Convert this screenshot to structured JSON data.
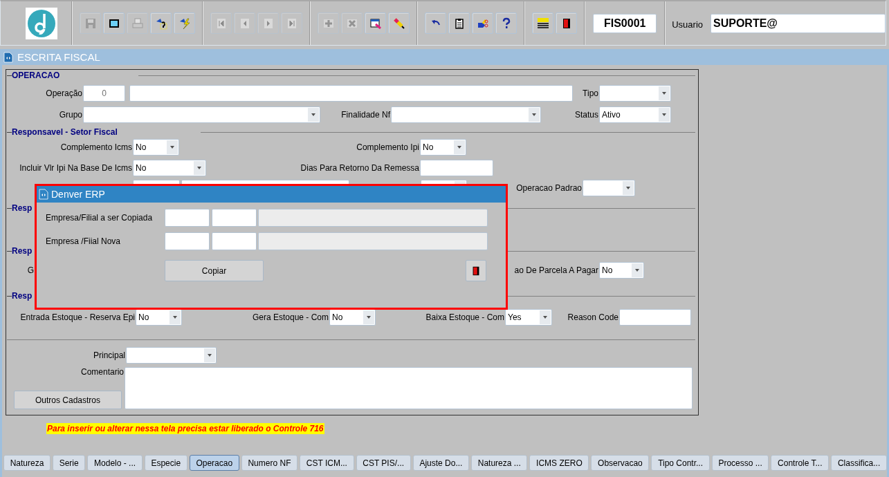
{
  "toolbar": {
    "groups": [
      {
        "buttons": [
          {
            "kind": "save",
            "disabled": true
          },
          {
            "kind": "window",
            "disabled": false
          },
          {
            "kind": "print",
            "disabled": true
          },
          {
            "kind": "query",
            "disabled": false
          },
          {
            "kind": "execute",
            "disabled": false
          }
        ]
      },
      {
        "buttons": [
          {
            "kind": "first",
            "disabled": true
          },
          {
            "kind": "prev",
            "disabled": true
          },
          {
            "kind": "next",
            "disabled": true
          },
          {
            "kind": "last",
            "disabled": true
          }
        ]
      },
      {
        "buttons": [
          {
            "kind": "insert",
            "disabled": true
          },
          {
            "kind": "delete",
            "disabled": true
          },
          {
            "kind": "edit",
            "disabled": false
          },
          {
            "kind": "clear",
            "disabled": false
          }
        ]
      },
      {
        "buttons": [
          {
            "kind": "undo",
            "disabled": false
          },
          {
            "kind": "clipboard",
            "disabled": false
          },
          {
            "kind": "hand",
            "disabled": false
          },
          {
            "kind": "help",
            "disabled": false
          }
        ]
      },
      {
        "buttons": [
          {
            "kind": "menu",
            "disabled": false
          },
          {
            "kind": "exit",
            "disabled": false
          }
        ]
      }
    ],
    "screen_code": "FIS0001",
    "user_label": "Usuario",
    "user": "SUPORTE@"
  },
  "window": {
    "title": "ESCRITA FISCAL"
  },
  "form": {
    "sections": [
      {
        "title": "OPERACAO",
        "rows": [
          [
            {
              "label": "Operação",
              "kind": "code",
              "value": "0"
            },
            {
              "kind": "text"
            },
            {
              "label": "Tipo",
              "kind": "combo"
            }
          ],
          [
            {
              "label": "Grupo",
              "kind": "combo"
            },
            {
              "label": "Finalidade Nf",
              "kind": "combo"
            },
            {
              "label": "Status",
              "kind": "combo",
              "value": "Ativo"
            }
          ]
        ]
      },
      {
        "title": "Responsavel - Setor Fiscal",
        "rows": [
          [
            {
              "label": "Complemento Icms",
              "kind": "combo",
              "value": "No"
            },
            {
              "label": "Complemento Ipi",
              "kind": "combo",
              "value": "No"
            }
          ],
          [
            {
              "label": "Incluir Vlr Ipi Na Base De Icms",
              "kind": "combo",
              "value": "No"
            },
            {
              "label": "Dias Para Retorno Da Remessa",
              "kind": "text"
            }
          ],
          [
            {
              "kind": "text"
            },
            {
              "kind": "text"
            },
            {
              "kind": "combo"
            },
            {
              "label": "Operacao Padrao",
              "kind": "combo"
            }
          ]
        ]
      },
      {
        "title": "Resp"
      },
      {
        "title": "Resp",
        "rows": [
          [
            {
              "label": "G",
              "kind": "label"
            },
            {
              "label": "ao De Parcela A Pagar",
              "kind": "combo",
              "value": "No"
            }
          ]
        ]
      },
      {
        "title": "Resp",
        "rows": [
          [
            {
              "label": "Entrada Estoque - Reserva Epi",
              "kind": "combo",
              "value": "No"
            },
            {
              "label": "Gera Estoque - Com",
              "kind": "combo",
              "value": "No"
            },
            {
              "label": "Baixa Estoque - Com",
              "kind": "combo",
              "value": "Yes"
            },
            {
              "label": "Reason Code",
              "kind": "text"
            }
          ]
        ]
      },
      {
        "rows": [
          [
            {
              "label": "Principal",
              "kind": "combo"
            }
          ],
          [
            {
              "kind": "button",
              "label": "Outros Cadastros"
            },
            {
              "kind": "memo",
              "label": "Comentario"
            }
          ]
        ]
      }
    ]
  },
  "message": "Para inserir ou alterar nessa tela precisa estar liberado o Controle 716",
  "dialog": {
    "title": "Denver ERP",
    "rows": [
      {
        "label": "Empresa/Filial a ser Copiada",
        "fields": [
          {
            "kind": "text"
          },
          {
            "kind": "text"
          },
          {
            "kind": "display"
          }
        ]
      },
      {
        "label": "Empresa /Fiial Nova",
        "fields": [
          {
            "kind": "text"
          },
          {
            "kind": "text"
          },
          {
            "kind": "display"
          }
        ]
      }
    ],
    "copy_button": "Copiar"
  },
  "tabs": [
    {
      "label": "Natureza",
      "selected": false
    },
    {
      "label": "Serie",
      "selected": false
    },
    {
      "label": "Modelo - ...",
      "selected": false
    },
    {
      "label": "Especie",
      "selected": false
    },
    {
      "label": "Operacao",
      "selected": true
    },
    {
      "label": "Numero NF",
      "selected": false
    },
    {
      "label": "CST ICM...",
      "selected": false
    },
    {
      "label": "CST PIS/...",
      "selected": false
    },
    {
      "label": "Ajuste Do...",
      "selected": false
    },
    {
      "label": "Natureza ...",
      "selected": false
    },
    {
      "label": "ICMS ZERO",
      "selected": false
    },
    {
      "label": "Observacao",
      "selected": false
    },
    {
      "label": "Tipo Contr...",
      "selected": false
    },
    {
      "label": "Processo ...",
      "selected": false
    },
    {
      "label": "Controle T...",
      "selected": false
    },
    {
      "label": "Classifica...",
      "selected": false
    }
  ]
}
